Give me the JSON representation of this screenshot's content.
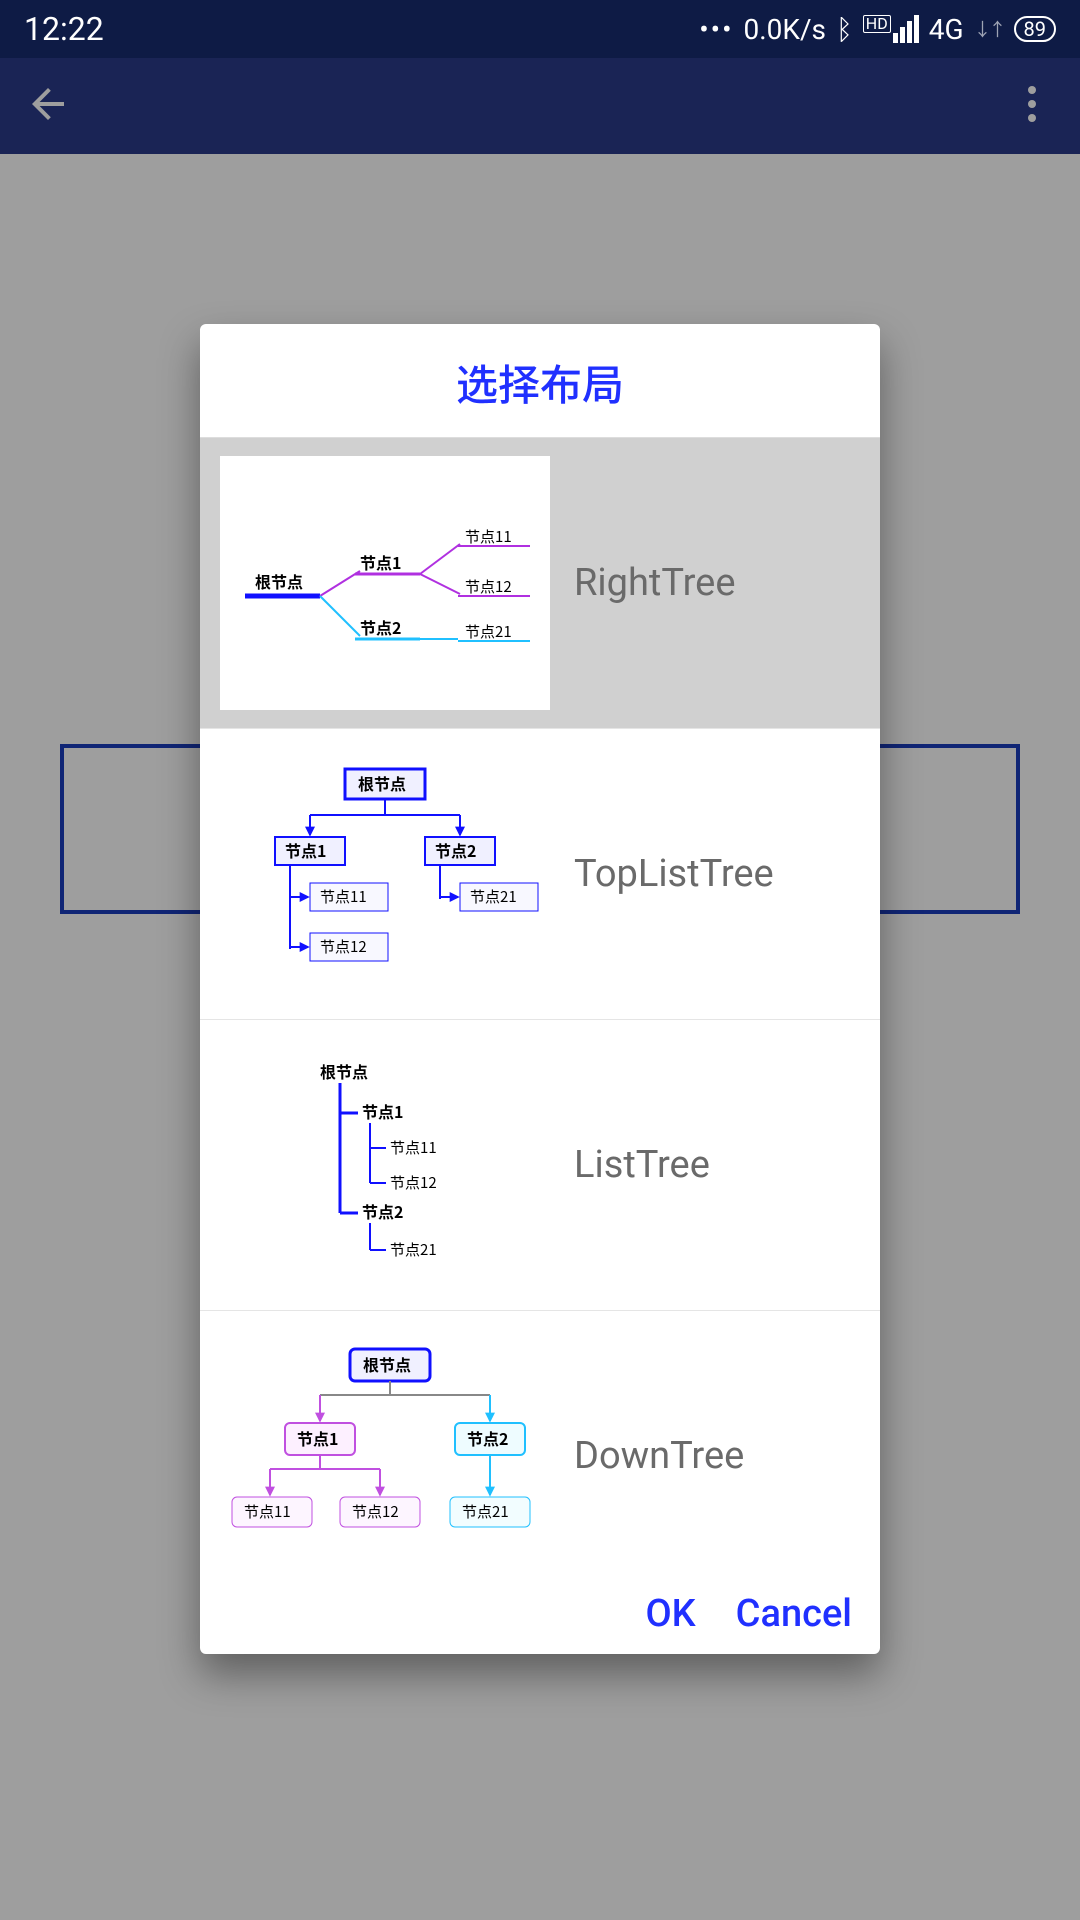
{
  "status": {
    "time": "12:22",
    "speed": "0.0K/s",
    "network": "4G",
    "hd": "HD",
    "battery": "89"
  },
  "dialog": {
    "title": "选择布局",
    "options": [
      {
        "label": "RightTree",
        "selected": true
      },
      {
        "label": "TopListTree",
        "selected": false
      },
      {
        "label": "ListTree",
        "selected": false
      },
      {
        "label": "DownTree",
        "selected": false
      }
    ],
    "ok": "OK",
    "cancel": "Cancel"
  },
  "tree_labels": {
    "root": "根节点",
    "n1": "节点1",
    "n2": "节点2",
    "n11": "节点11",
    "n12": "节点12",
    "n21": "节点21"
  }
}
